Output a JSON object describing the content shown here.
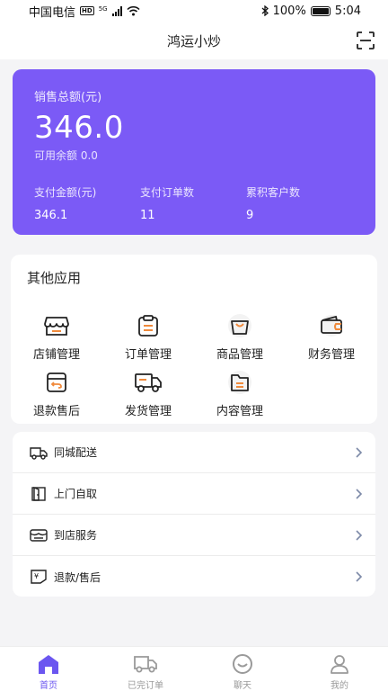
{
  "status_bar": {
    "carrier": "中国电信",
    "hd": "HD",
    "net": "5G",
    "battery": "100%",
    "time": "5:04"
  },
  "header": {
    "title": "鸿运小炒",
    "scan_icon": "scan-icon"
  },
  "sales": {
    "label": "销售总额(元)",
    "total": "346.0",
    "available": "可用余额 0.0",
    "stats": [
      {
        "label": "支付金额(元)",
        "value": "346.1"
      },
      {
        "label": "支付订单数",
        "value": "11"
      },
      {
        "label": "累积客户数",
        "value": "9"
      }
    ],
    "accent_color": "#7b5af6"
  },
  "other_apps": {
    "title": "其他应用",
    "items": [
      {
        "label": "店铺管理",
        "icon": "store-icon"
      },
      {
        "label": "订单管理",
        "icon": "clipboard-icon"
      },
      {
        "label": "商品管理",
        "icon": "shopping-bag-icon"
      },
      {
        "label": "财务管理",
        "icon": "wallet-icon"
      },
      {
        "label": "退款售后",
        "icon": "refund-box-icon"
      },
      {
        "label": "发货管理",
        "icon": "truck-icon"
      },
      {
        "label": "内容管理",
        "icon": "folder-icon"
      }
    ]
  },
  "services": [
    {
      "label": "同城配送",
      "icon": "delivery-van-icon"
    },
    {
      "label": "上门自取",
      "icon": "door-icon"
    },
    {
      "label": "到店服务",
      "icon": "shop-awning-icon"
    },
    {
      "label": "退款/售后",
      "icon": "yen-return-icon"
    }
  ],
  "tabbar": {
    "items": [
      {
        "label": "首页",
        "icon": "home-icon",
        "active": true
      },
      {
        "label": "已完订单",
        "icon": "truck-icon",
        "active": false
      },
      {
        "label": "聊天",
        "icon": "chat-face-icon",
        "active": false
      },
      {
        "label": "我的",
        "icon": "user-icon",
        "active": false
      }
    ],
    "active_color": "#6b56f0"
  }
}
